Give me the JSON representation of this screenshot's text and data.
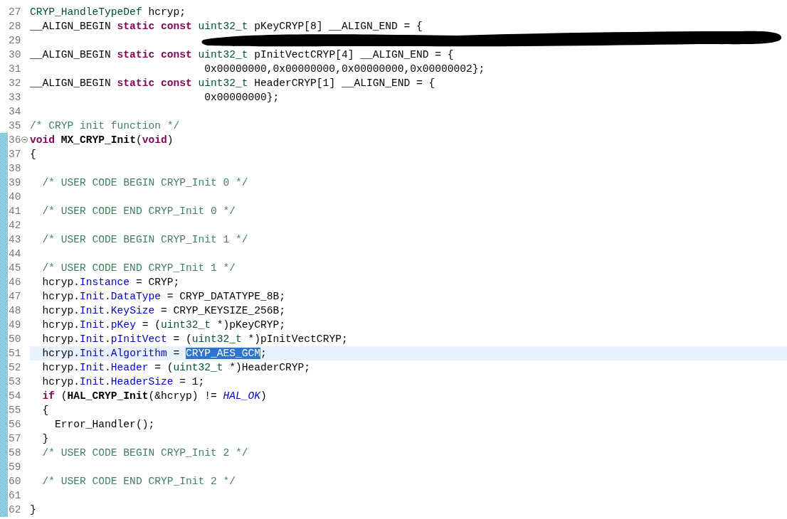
{
  "editor": {
    "lines": [
      {
        "number": "27",
        "marked": false,
        "current": false,
        "tokens": [
          {
            "kind": "type",
            "text": "CRYP_HandleTypeDef"
          },
          {
            "kind": "plain",
            "text": " hcryp;"
          }
        ]
      },
      {
        "number": "28",
        "marked": false,
        "current": false,
        "tokens": [
          {
            "kind": "plain",
            "text": "__ALIGN_BEGIN "
          },
          {
            "kind": "keyword",
            "text": "static "
          },
          {
            "kind": "keyword",
            "text": "const "
          },
          {
            "kind": "type",
            "text": "uint32_t"
          },
          {
            "kind": "plain",
            "text": " pKeyCRYP[8] __ALIGN_END = {"
          }
        ]
      },
      {
        "number": "29",
        "marked": false,
        "current": false,
        "redacted": true
      },
      {
        "number": "30",
        "marked": false,
        "current": false,
        "tokens": [
          {
            "kind": "plain",
            "text": "__ALIGN_BEGIN "
          },
          {
            "kind": "keyword",
            "text": "static "
          },
          {
            "kind": "keyword",
            "text": "const "
          },
          {
            "kind": "type",
            "text": "uint32_t"
          },
          {
            "kind": "plain",
            "text": " pInitVectCRYP[4] __ALIGN_END = {"
          }
        ]
      },
      {
        "number": "31",
        "marked": false,
        "current": false,
        "tokens": [
          {
            "kind": "plain",
            "text": "                            0x00000000,0x00000000,0x00000000,0x00000002};"
          }
        ]
      },
      {
        "number": "32",
        "marked": false,
        "current": false,
        "tokens": [
          {
            "kind": "plain",
            "text": "__ALIGN_BEGIN "
          },
          {
            "kind": "keyword",
            "text": "static "
          },
          {
            "kind": "keyword",
            "text": "const "
          },
          {
            "kind": "type",
            "text": "uint32_t"
          },
          {
            "kind": "plain",
            "text": " HeaderCRYP[1] __ALIGN_END = {"
          }
        ]
      },
      {
        "number": "33",
        "marked": false,
        "current": false,
        "tokens": [
          {
            "kind": "plain",
            "text": "                            0x00000000};"
          }
        ]
      },
      {
        "number": "34",
        "marked": false,
        "current": false
      },
      {
        "number": "35",
        "marked": false,
        "current": false,
        "tokens": [
          {
            "kind": "comment",
            "text": "/* CRYP init function */"
          }
        ]
      },
      {
        "number": "36",
        "marked": true,
        "current": false,
        "expanded": true,
        "tokens": [
          {
            "kind": "keyword",
            "text": "void "
          },
          {
            "kind": "bold",
            "text": "MX_CRYP_Init"
          },
          {
            "kind": "plain",
            "text": "("
          },
          {
            "kind": "keyword",
            "text": "void"
          },
          {
            "kind": "plain",
            "text": ")"
          }
        ]
      },
      {
        "number": "37",
        "marked": true,
        "current": false,
        "tokens": [
          {
            "kind": "plain",
            "text": "{"
          }
        ]
      },
      {
        "number": "38",
        "marked": true,
        "current": false
      },
      {
        "number": "39",
        "marked": true,
        "current": false,
        "tokens": [
          {
            "kind": "comment",
            "text": "  /* USER CODE BEGIN CRYP_Init 0 */"
          }
        ]
      },
      {
        "number": "40",
        "marked": true,
        "current": false
      },
      {
        "number": "41",
        "marked": true,
        "current": false,
        "tokens": [
          {
            "kind": "comment",
            "text": "  /* USER CODE END CRYP_Init 0 */"
          }
        ]
      },
      {
        "number": "42",
        "marked": true,
        "current": false
      },
      {
        "number": "43",
        "marked": true,
        "current": false,
        "tokens": [
          {
            "kind": "comment",
            "text": "  /* USER CODE BEGIN CRYP_Init 1 */"
          }
        ]
      },
      {
        "number": "44",
        "marked": true,
        "current": false
      },
      {
        "number": "45",
        "marked": true,
        "current": false,
        "tokens": [
          {
            "kind": "comment",
            "text": "  /* USER CODE END CRYP_Init 1 */"
          }
        ]
      },
      {
        "number": "46",
        "marked": true,
        "current": false,
        "tokens": [
          {
            "kind": "plain",
            "text": "  hcryp."
          },
          {
            "kind": "field",
            "text": "Instance"
          },
          {
            "kind": "plain",
            "text": " = CRYP;"
          }
        ]
      },
      {
        "number": "47",
        "marked": true,
        "current": false,
        "tokens": [
          {
            "kind": "plain",
            "text": "  hcryp."
          },
          {
            "kind": "field",
            "text": "Init"
          },
          {
            "kind": "plain",
            "text": "."
          },
          {
            "kind": "field",
            "text": "DataType"
          },
          {
            "kind": "plain",
            "text": " = CRYP_DATATYPE_8B;"
          }
        ]
      },
      {
        "number": "48",
        "marked": true,
        "current": false,
        "tokens": [
          {
            "kind": "plain",
            "text": "  hcryp."
          },
          {
            "kind": "field",
            "text": "Init"
          },
          {
            "kind": "plain",
            "text": "."
          },
          {
            "kind": "field",
            "text": "KeySize"
          },
          {
            "kind": "plain",
            "text": " = CRYP_KEYSIZE_256B;"
          }
        ]
      },
      {
        "number": "49",
        "marked": true,
        "current": false,
        "tokens": [
          {
            "kind": "plain",
            "text": "  hcryp."
          },
          {
            "kind": "field",
            "text": "Init"
          },
          {
            "kind": "plain",
            "text": "."
          },
          {
            "kind": "field",
            "text": "pKey"
          },
          {
            "kind": "plain",
            "text": " = ("
          },
          {
            "kind": "type",
            "text": "uint32_t"
          },
          {
            "kind": "plain",
            "text": " *)pKeyCRYP;"
          }
        ]
      },
      {
        "number": "50",
        "marked": true,
        "current": false,
        "tokens": [
          {
            "kind": "plain",
            "text": "  hcryp."
          },
          {
            "kind": "field",
            "text": "Init"
          },
          {
            "kind": "plain",
            "text": "."
          },
          {
            "kind": "field",
            "text": "pInitVect"
          },
          {
            "kind": "plain",
            "text": " = ("
          },
          {
            "kind": "type",
            "text": "uint32_t"
          },
          {
            "kind": "plain",
            "text": " *)pInitVectCRYP;"
          }
        ]
      },
      {
        "number": "51",
        "marked": true,
        "current": true,
        "tokens": [
          {
            "kind": "plain",
            "text": "  hcryp."
          },
          {
            "kind": "field",
            "text": "Init"
          },
          {
            "kind": "plain",
            "text": "."
          },
          {
            "kind": "field",
            "text": "Algorithm"
          },
          {
            "kind": "plain",
            "text": " = "
          },
          {
            "kind": "selection",
            "text": "CRYP_AES_GCM"
          },
          {
            "kind": "plain",
            "text": ";"
          }
        ]
      },
      {
        "number": "52",
        "marked": true,
        "current": false,
        "tokens": [
          {
            "kind": "plain",
            "text": "  hcryp."
          },
          {
            "kind": "field",
            "text": "Init"
          },
          {
            "kind": "plain",
            "text": "."
          },
          {
            "kind": "field",
            "text": "Header"
          },
          {
            "kind": "plain",
            "text": " = ("
          },
          {
            "kind": "type",
            "text": "uint32_t"
          },
          {
            "kind": "plain",
            "text": " *)HeaderCRYP;"
          }
        ]
      },
      {
        "number": "53",
        "marked": true,
        "current": false,
        "tokens": [
          {
            "kind": "plain",
            "text": "  hcryp."
          },
          {
            "kind": "field",
            "text": "Init"
          },
          {
            "kind": "plain",
            "text": "."
          },
          {
            "kind": "field",
            "text": "HeaderSize"
          },
          {
            "kind": "plain",
            "text": " = 1;"
          }
        ]
      },
      {
        "number": "54",
        "marked": true,
        "current": false,
        "tokens": [
          {
            "kind": "keyword",
            "text": "  if"
          },
          {
            "kind": "plain",
            "text": " ("
          },
          {
            "kind": "bold",
            "text": "HAL_CRYP_Init"
          },
          {
            "kind": "plain",
            "text": "(&hcryp) != "
          },
          {
            "kind": "constant",
            "text": "HAL_OK"
          },
          {
            "kind": "plain",
            "text": ")"
          }
        ]
      },
      {
        "number": "55",
        "marked": true,
        "current": false,
        "tokens": [
          {
            "kind": "plain",
            "text": "  {"
          }
        ]
      },
      {
        "number": "56",
        "marked": true,
        "current": false,
        "tokens": [
          {
            "kind": "plain",
            "text": "    Error_Handler();"
          }
        ]
      },
      {
        "number": "57",
        "marked": true,
        "current": false,
        "tokens": [
          {
            "kind": "plain",
            "text": "  }"
          }
        ]
      },
      {
        "number": "58",
        "marked": true,
        "current": false,
        "tokens": [
          {
            "kind": "comment",
            "text": "  /* USER CODE BEGIN CRYP_Init 2 */"
          }
        ]
      },
      {
        "number": "59",
        "marked": true,
        "current": false
      },
      {
        "number": "60",
        "marked": true,
        "current": false,
        "tokens": [
          {
            "kind": "comment",
            "text": "  /* USER CODE END CRYP_Init 2 */"
          }
        ]
      },
      {
        "number": "61",
        "marked": true,
        "current": false
      },
      {
        "number": "62",
        "marked": true,
        "current": false,
        "tokens": [
          {
            "kind": "plain",
            "text": "}"
          }
        ]
      }
    ]
  }
}
